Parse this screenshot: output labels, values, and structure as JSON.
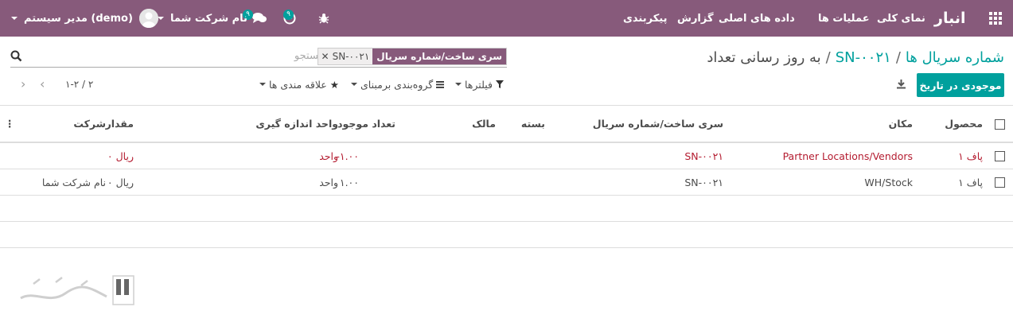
{
  "navbar": {
    "app_name": "انبار",
    "menu": [
      "نمای کلی",
      "عملیات ها",
      "داده های اصلی",
      "گزارش",
      "پیکربندی"
    ],
    "company": "نام شرکت شما",
    "messages_count": "۹",
    "activities_count": "۹",
    "user": "مدیر سیستم (demo)"
  },
  "breadcrumb": {
    "root": "شماره سریال ها",
    "parent": "SN-۰۰۲۱",
    "current": "به روز رسانی تعداد"
  },
  "search": {
    "facet_label": "سری ساخت/شماره سریال",
    "facet_value": "SN-۰۰۲۱",
    "placeholder": "جستجو..."
  },
  "toolbar": {
    "primary_button": "موجودی در تاریخ",
    "filters": "فیلترها",
    "group_by": "گروه‌بندی برمبنای",
    "favorites": "علاقه مندی ها"
  },
  "pager": {
    "text": "۱-۲ / ۲"
  },
  "table": {
    "columns": {
      "product": "محصول",
      "location": "مکان",
      "lot": "سری ساخت/شماره سریال",
      "package": "بسته",
      "owner": "مالک",
      "quantity": "تعداد موجود",
      "uom": "واحد اندازه گیری",
      "value": "مقدار",
      "company": "شرکت"
    },
    "rows": [
      {
        "product": "پاف ۱",
        "location": "Partner Locations/Vendors",
        "lot": "SN-۰۰۲۱",
        "package": "",
        "owner": "",
        "quantity": "-۱.۰۰",
        "uom": "واحد",
        "value": "۰ ریال",
        "company": ""
      },
      {
        "product": "پاف ۱",
        "location": "WH/Stock",
        "lot": "SN-۰۰۲۱",
        "package": "",
        "owner": "",
        "quantity": "۱.۰۰",
        "uom": "واحد",
        "value": "۰ ریال",
        "company": "نام شرکت شما"
      }
    ]
  },
  "colors": {
    "brand": "#875a7b",
    "accent": "#00a09d",
    "negative": "#b41c30"
  }
}
